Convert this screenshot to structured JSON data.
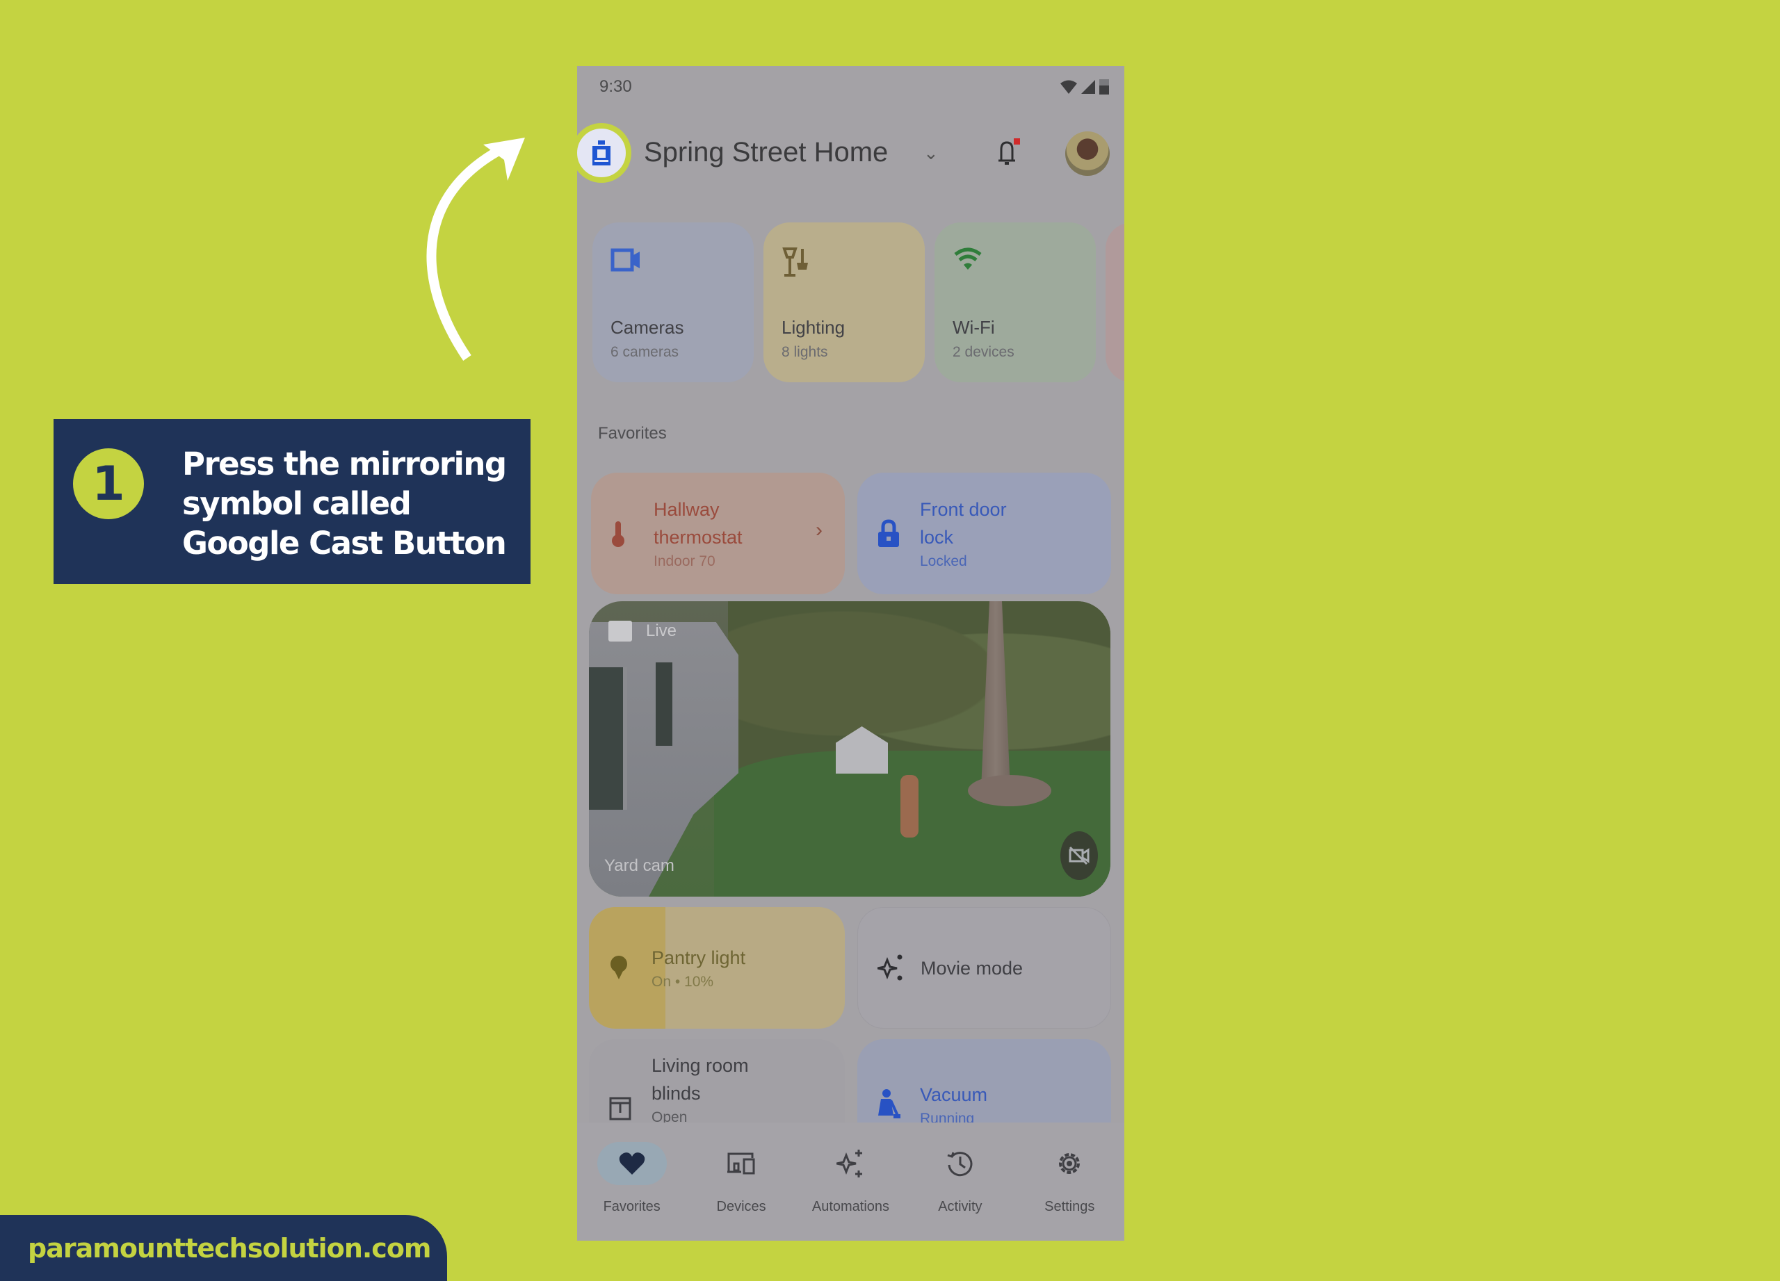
{
  "page": {
    "background_color": "#c4d341",
    "accent_navy": "#1f3358"
  },
  "callout": {
    "step_number": "1",
    "text": "Press the mirroring symbol called Google Cast Button"
  },
  "footer": {
    "site": "paramounttechsolution.com"
  },
  "phone": {
    "status_bar": {
      "time": "9:30",
      "icons": [
        "wifi-icon",
        "cellular-signal-icon",
        "battery-icon"
      ]
    },
    "header": {
      "home_icon": "home-cast-icon",
      "home_name": "Spring Street Home",
      "dropdown_icon": "chevron-down-icon",
      "notification_icon": "bell-icon",
      "notification_badge": true,
      "avatar": "user-avatar"
    },
    "categories": [
      {
        "title": "Cameras",
        "subtitle": "6 cameras",
        "icon": "camera-icon",
        "color": "#3a63c9"
      },
      {
        "title": "Lighting",
        "subtitle": "8 lights",
        "icon": "lamp-icon",
        "color": "#7a6a3a"
      },
      {
        "title": "Wi-Fi",
        "subtitle": "2 devices",
        "icon": "wifi-icon",
        "color": "#2f7d3a"
      }
    ],
    "favorites_label": "Favorites",
    "favorites": {
      "thermostat": {
        "title_line1": "Hallway",
        "title_line2": "thermostat",
        "subtitle": "Indoor 70",
        "icon": "thermometer-icon",
        "has_chevron": true
      },
      "lock": {
        "title_line1": "Front door",
        "title_line2": "lock",
        "subtitle": "Locked",
        "icon": "lock-icon"
      },
      "camera": {
        "live_label": "Live",
        "name": "Yard cam",
        "toggle_icon": "camera-off-icon"
      },
      "pantry": {
        "title": "Pantry light",
        "subtitle": "On • 10%",
        "icon": "bulb-icon",
        "brightness_percent": 10
      },
      "movie": {
        "title": "Movie mode",
        "icon": "sparkle-icon"
      },
      "blinds": {
        "title_line1": "Living room",
        "title_line2": "blinds",
        "subtitle": "Open",
        "icon": "blinds-icon"
      },
      "vacuum": {
        "title": "Vacuum",
        "subtitle": "Running",
        "icon": "vacuum-icon"
      }
    },
    "bottom_nav": [
      {
        "label": "Favorites",
        "icon": "heart-icon",
        "active": true
      },
      {
        "label": "Devices",
        "icon": "devices-icon",
        "active": false
      },
      {
        "label": "Automations",
        "icon": "sparkle-icon",
        "active": false
      },
      {
        "label": "Activity",
        "icon": "history-icon",
        "active": false
      },
      {
        "label": "Settings",
        "icon": "gear-icon",
        "active": false
      }
    ]
  }
}
